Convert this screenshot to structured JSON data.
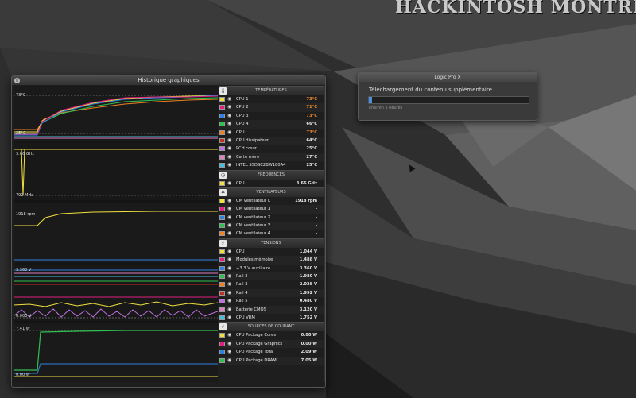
{
  "desktop": {
    "watermark": "HACKINTOSH MONTREA"
  },
  "window": {
    "title": "Historique graphiques"
  },
  "graph_labels": {
    "temp_top": "73°C",
    "temp_bottom": "25°C",
    "freq_top": "3.66 GHz",
    "freq_bottom": "792 MHz",
    "fan_top": "1918 rpm",
    "volt_top": "3.360 V",
    "volt_bottom": "0.000 V",
    "power_top": "7.41 W",
    "power_bottom": "0.00 W"
  },
  "sections": [
    {
      "title": "TEMPÉRATURES",
      "icon": "thermometer-icon",
      "icon_glyph": "🌡",
      "rows": [
        {
          "name": "CPU 1",
          "value": "73°C",
          "color": "#f0e040",
          "hot": true
        },
        {
          "name": "CPU 2",
          "value": "71°C",
          "color": "#e02080",
          "hot": true
        },
        {
          "name": "CPU 3",
          "value": "73°C",
          "color": "#3080e0",
          "hot": true
        },
        {
          "name": "CPU 4",
          "value": "66°C",
          "color": "#30c050",
          "hot": false
        },
        {
          "name": "CPU",
          "value": "73°C",
          "color": "#f08020",
          "hot": true
        },
        {
          "name": "CPU dissipateur",
          "value": "64°C",
          "color": "#c03020",
          "hot": false
        },
        {
          "name": "PCH cœur",
          "value": "25°C",
          "color": "#c070e0",
          "hot": false
        },
        {
          "name": "Carte mère",
          "value": "27°C",
          "color": "#e080c0",
          "hot": false
        },
        {
          "name": "INTEL SSDSC2BW180A4",
          "value": "25°C",
          "color": "#40c0e0",
          "hot": false
        }
      ]
    },
    {
      "title": "FRÉQUENCES",
      "icon": "clock-icon",
      "icon_glyph": "◷",
      "rows": [
        {
          "name": "CPU",
          "value": "3.66 GHz",
          "color": "#f0e040",
          "hot": false
        }
      ]
    },
    {
      "title": "VENTILATEURS",
      "icon": "fan-icon",
      "icon_glyph": "✲",
      "rows": [
        {
          "name": "CM ventilateur 0",
          "value": "1918 rpm",
          "color": "#f0e040",
          "hot": false
        },
        {
          "name": "CM ventilateur 1",
          "value": "-",
          "color": "#e02080",
          "hot": false
        },
        {
          "name": "CM ventilateur 2",
          "value": "-",
          "color": "#3080e0",
          "hot": false
        },
        {
          "name": "CM ventilateur 3",
          "value": "-",
          "color": "#30c050",
          "hot": false
        },
        {
          "name": "CM ventilateur 4",
          "value": "-",
          "color": "#f08020",
          "hot": false
        }
      ]
    },
    {
      "title": "TENSIONS",
      "icon": "lightning-icon",
      "icon_glyph": "⚡",
      "rows": [
        {
          "name": "CPU",
          "value": "1.044 V",
          "color": "#f0e040",
          "hot": false
        },
        {
          "name": "Modules mémoire",
          "value": "1.488 V",
          "color": "#e02080",
          "hot": false
        },
        {
          "name": "+3.3 V auxiliaire",
          "value": "3.360 V",
          "color": "#3080e0",
          "hot": false
        },
        {
          "name": "Rail 2",
          "value": "1.980 V",
          "color": "#30c050",
          "hot": false
        },
        {
          "name": "Rail 3",
          "value": "2.028 V",
          "color": "#f08020",
          "hot": false
        },
        {
          "name": "Rail 4",
          "value": "1.992 V",
          "color": "#c03020",
          "hot": false
        },
        {
          "name": "Rail 5",
          "value": "0.480 V",
          "color": "#c070e0",
          "hot": false
        },
        {
          "name": "Batterie CMOS",
          "value": "3.120 V",
          "color": "#e080c0",
          "hot": false
        },
        {
          "name": "CPU VRM",
          "value": "1.752 V",
          "color": "#40c0e0",
          "hot": false
        }
      ]
    },
    {
      "title": "SOURCES DE COURANT",
      "icon": "lightning-icon",
      "icon_glyph": "⚡",
      "rows": [
        {
          "name": "CPU Package Cores",
          "value": "0.00 W",
          "color": "#f0e040",
          "hot": false
        },
        {
          "name": "CPU Package Graphics",
          "value": "0.00 W",
          "color": "#e02080",
          "hot": false
        },
        {
          "name": "CPU Package Total",
          "value": "2.09 W",
          "color": "#3080e0",
          "hot": false
        },
        {
          "name": "CPU Package DRAM",
          "value": "7.05 W",
          "color": "#30c050",
          "hot": false
        }
      ]
    }
  ],
  "dialog": {
    "title": "Logic Pro X",
    "message": "Téléchargement du contenu supplémentaire…",
    "progress": 0.02,
    "subtext": "Environ 5 heures"
  },
  "colors": {
    "accent_hot": "#e88a2e",
    "progress": "#4a90e2"
  }
}
